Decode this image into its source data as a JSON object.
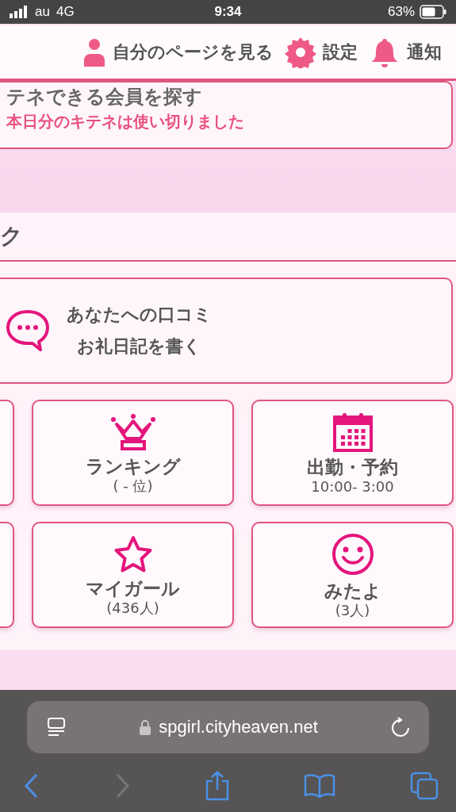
{
  "status_bar": {
    "carrier": "au",
    "network": "4G",
    "time": "9:34",
    "battery": "63%"
  },
  "header_links": [
    {
      "kind": "user",
      "label": "自分のページを見る"
    },
    {
      "kind": "gear",
      "label": "設定"
    },
    {
      "kind": "bell",
      "label": "通知"
    }
  ],
  "search_card": {
    "title": "テネできる会員を探す",
    "notice": "本日分のキテネは使い切りました"
  },
  "section": {
    "title": "ク",
    "review_card": {
      "lines": [
        "あなたへの口コミ",
        "お礼日記を書く"
      ]
    },
    "tiles": [
      {
        "kind": "blank"
      },
      {
        "kind": "crown",
        "label": "ランキング",
        "sub": "( - 位)"
      },
      {
        "kind": "calendar",
        "label": "出勤・予約",
        "sub": "10:00- 3:00"
      },
      {
        "kind": "blank"
      },
      {
        "kind": "star",
        "label": "マイガール",
        "sub": "(436人)"
      },
      {
        "kind": "smile",
        "label": "みたよ",
        "sub": "(3人)"
      }
    ]
  },
  "browser": {
    "url": "spgirl.cityheaven.net"
  }
}
